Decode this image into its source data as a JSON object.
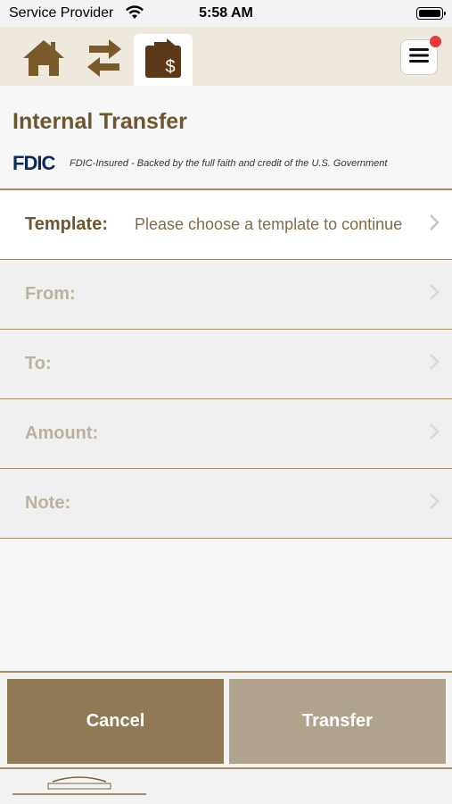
{
  "status_bar": {
    "carrier": "Service Provider",
    "time": "5:58 AM"
  },
  "nav": {
    "tabs": [
      {
        "name": "home",
        "icon": "home-icon"
      },
      {
        "name": "transfer",
        "icon": "arrows-transfer-icon"
      },
      {
        "name": "bill-pay",
        "icon": "bill-pay-icon",
        "active": true
      }
    ],
    "menu_icon": "hamburger-menu-icon",
    "notification_color": "#e53940"
  },
  "page": {
    "title": "Internal Transfer",
    "fdic_logo": "FDIC",
    "fdic_text": "FDIC-Insured - Backed by the full faith and credit of the U.S. Government"
  },
  "form": {
    "template": {
      "label": "Template:",
      "value": "Please choose a template to continue"
    },
    "from": {
      "label": "From:",
      "value": ""
    },
    "to": {
      "label": "To:",
      "value": ""
    },
    "amount": {
      "label": "Amount:",
      "value": ""
    },
    "note": {
      "label": "Note:",
      "value": ""
    }
  },
  "buttons": {
    "cancel": "Cancel",
    "transfer": "Transfer"
  },
  "colors": {
    "brand_brown": "#6e5630",
    "button_dark": "#8f7a55",
    "button_light": "#b0a38c",
    "divider": "#a38e68"
  }
}
